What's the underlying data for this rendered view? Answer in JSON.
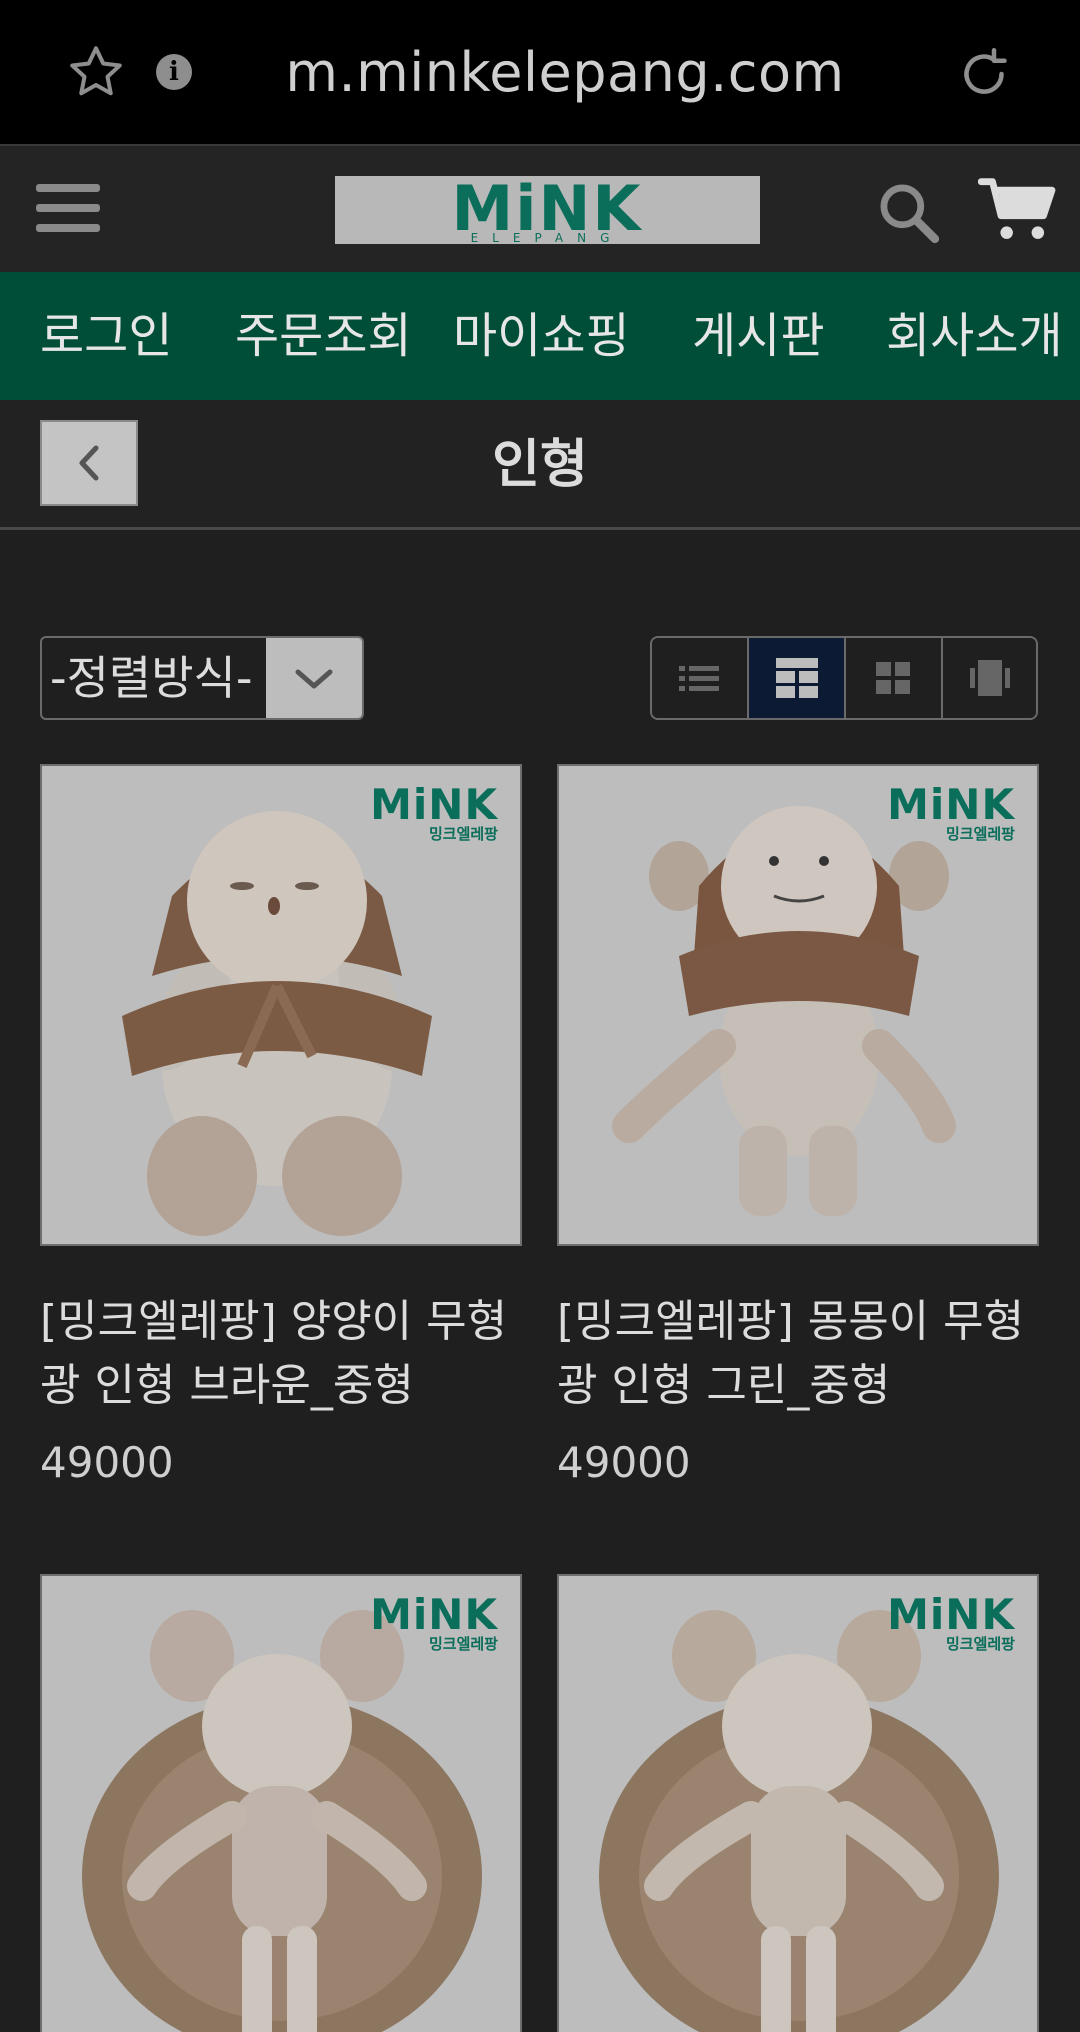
{
  "browser": {
    "url": "m.minkelepang.com",
    "icons": [
      "star-icon",
      "info-icon",
      "reload-icon"
    ]
  },
  "header": {
    "logo_text": "MiNK",
    "logo_subtext": "ELEPANG",
    "icons": [
      "menu-icon",
      "search-icon",
      "cart-icon"
    ]
  },
  "nav": {
    "items": [
      {
        "label": "로그인"
      },
      {
        "label": "주문조회"
      },
      {
        "label": "마이쇼핑"
      },
      {
        "label": "게시판"
      },
      {
        "label": "회사소개"
      }
    ]
  },
  "page": {
    "title": "인형"
  },
  "toolbar": {
    "sort_label": "-정렬방식-",
    "view_modes": [
      "list",
      "gallery-large",
      "grid",
      "slide"
    ],
    "active_view": "gallery-large"
  },
  "products": [
    {
      "name": "[밍크엘레팡] 양양이 무형광 인형 브라운_중형",
      "price": "49000",
      "watermark": "MiNK",
      "watermark_sub": "밍크엘레팡"
    },
    {
      "name": "[밍크엘레팡] 몽몽이 무형광 인형 그린_중형",
      "price": "49000",
      "watermark": "MiNK",
      "watermark_sub": "밍크엘레팡"
    },
    {
      "name": "",
      "price": "",
      "watermark": "MiNK",
      "watermark_sub": "밍크엘레팡"
    },
    {
      "name": "",
      "price": "",
      "watermark": "MiNK",
      "watermark_sub": "밍크엘레팡"
    }
  ],
  "colors": {
    "nav_bg": "#004d38",
    "brand_green": "#0a6e5a",
    "page_bg": "#1f1f1f",
    "active_view_bg": "#0c1a33"
  }
}
